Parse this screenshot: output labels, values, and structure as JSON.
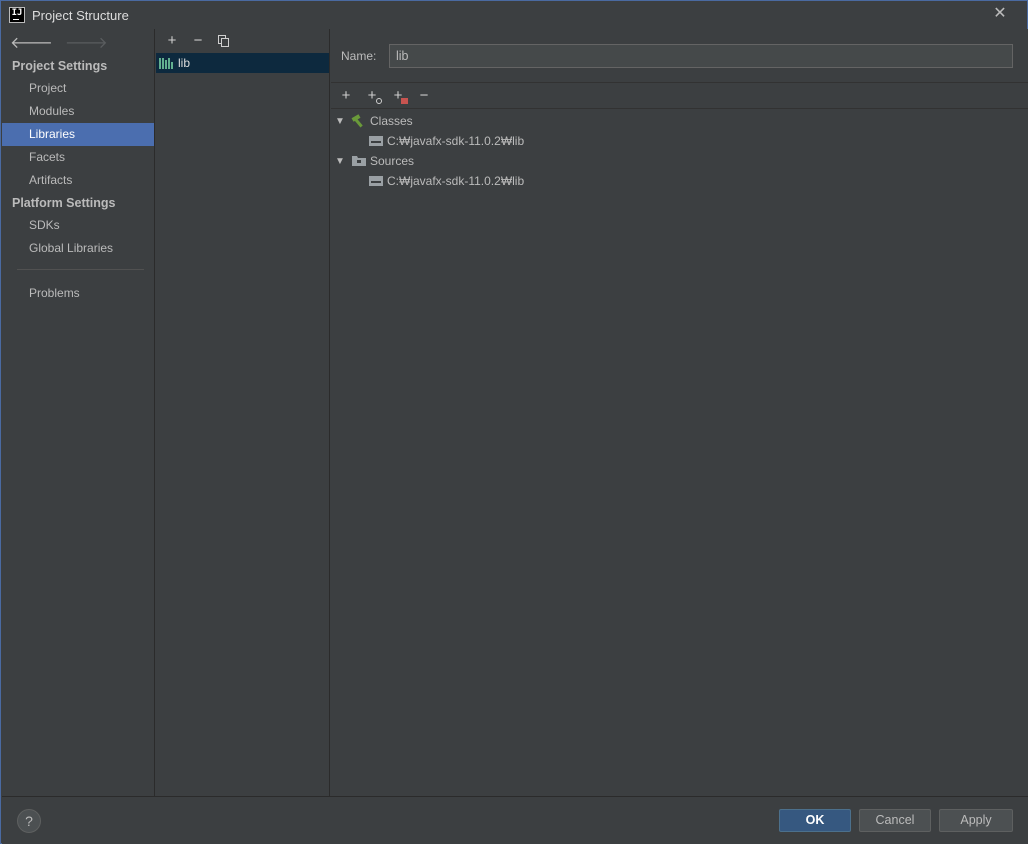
{
  "window": {
    "title": "Project Structure"
  },
  "sidebar": {
    "project_settings_title": "Project Settings",
    "project_items": [
      {
        "label": "Project"
      },
      {
        "label": "Modules"
      },
      {
        "label": "Libraries",
        "selected": true
      },
      {
        "label": "Facets"
      },
      {
        "label": "Artifacts"
      }
    ],
    "platform_settings_title": "Platform Settings",
    "platform_items": [
      {
        "label": "SDKs"
      },
      {
        "label": "Global Libraries"
      }
    ],
    "problems_label": "Problems"
  },
  "libraries": {
    "items": [
      {
        "label": "lib",
        "selected": true
      }
    ]
  },
  "detail": {
    "name_label": "Name:",
    "name_value": "lib",
    "tree": {
      "classes_label": "Classes",
      "classes_path": "C:₩javafx-sdk-11.0.2₩lib",
      "sources_label": "Sources",
      "sources_path": "C:₩javafx-sdk-11.0.2₩lib"
    }
  },
  "buttons": {
    "help": "?",
    "ok": "OK",
    "cancel": "Cancel",
    "apply": "Apply"
  },
  "colors": {
    "background": "#3c3f41",
    "selection": "#4b6eaf",
    "list_selection": "#0d293e",
    "ok_button": "#365880",
    "library_icon": "#62b08f",
    "classes_icon": "#6a9a3a",
    "remove_badge": "#c75450"
  }
}
